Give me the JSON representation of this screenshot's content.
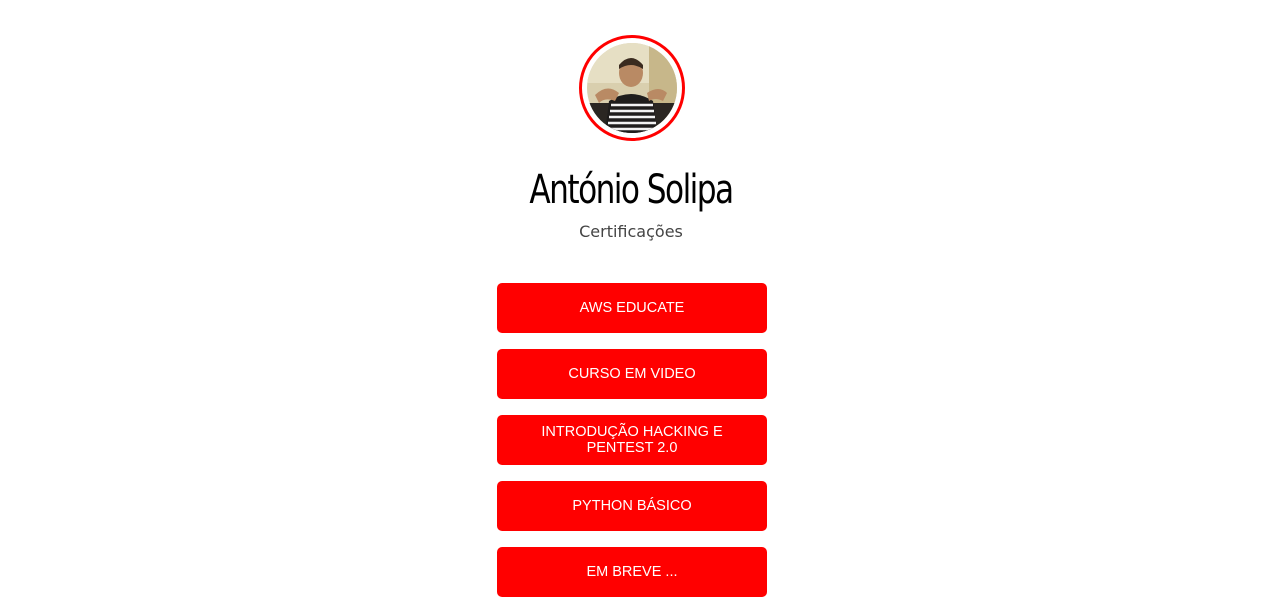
{
  "profile": {
    "name": "António Solipa",
    "subtitle": "Certificações",
    "avatar": "profile-photo",
    "accent_color": "#ff0000"
  },
  "links": [
    {
      "label": "AWS EDUCATE"
    },
    {
      "label": "CURSO EM VIDEO"
    },
    {
      "label": "INTRODUÇÃO HACKING E PENTEST 2.0"
    },
    {
      "label": "PYTHON BÁSICO"
    },
    {
      "label": "EM BREVE ..."
    }
  ]
}
